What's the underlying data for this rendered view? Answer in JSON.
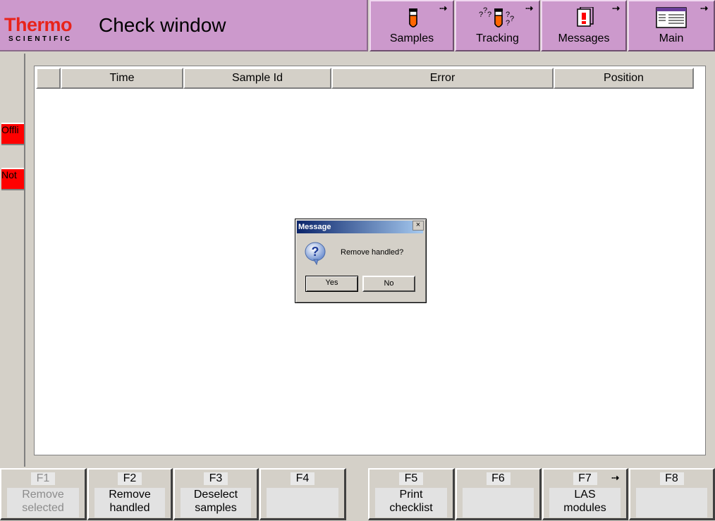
{
  "header": {
    "logo_main": "Thermo",
    "logo_sub": "SCIENTIFIC",
    "title": "Check window"
  },
  "nav": [
    {
      "label": "Samples",
      "icon": "test-tube-icon"
    },
    {
      "label": "Tracking",
      "icon": "tracking-icon"
    },
    {
      "label": "Messages",
      "icon": "messages-icon"
    },
    {
      "label": "Main",
      "icon": "main-window-icon"
    }
  ],
  "sidebar": [
    {
      "label": "Offli",
      "color": "#ff0000"
    },
    {
      "label": "Not",
      "color": "#ff0000"
    }
  ],
  "table": {
    "columns": [
      "",
      "Time",
      "Sample Id",
      "Error",
      "Position"
    ]
  },
  "dialog": {
    "title": "Message",
    "text": "Remove handled?",
    "yes": "Yes",
    "no": "No",
    "icon": "question-icon"
  },
  "fkeys": [
    {
      "key": "F1",
      "label1": "Remove",
      "label2": "selected",
      "disabled": true
    },
    {
      "key": "F2",
      "label1": "Remove",
      "label2": "handled"
    },
    {
      "key": "F3",
      "label1": "Deselect",
      "label2": "samples"
    },
    {
      "key": "F4",
      "label1": "",
      "label2": ""
    },
    {
      "key": "F5",
      "label1": "Print",
      "label2": "checklist"
    },
    {
      "key": "F6",
      "label1": "",
      "label2": ""
    },
    {
      "key": "F7",
      "label1": "LAS",
      "label2": "modules"
    },
    {
      "key": "F8",
      "label1": "",
      "label2": ""
    }
  ],
  "colors": {
    "header_bg": "#cc99cc",
    "logo_red": "#e8231b",
    "status_red": "#ff0000"
  }
}
